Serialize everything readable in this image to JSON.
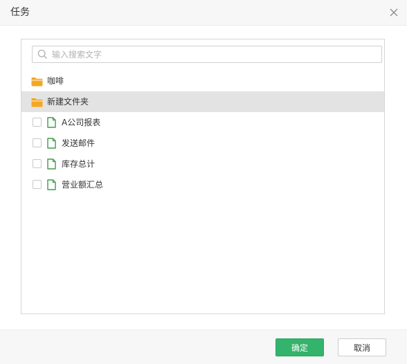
{
  "dialog": {
    "title": "任务"
  },
  "search": {
    "placeholder": "输入搜索文字",
    "value": ""
  },
  "tree": {
    "folders": [
      {
        "label": "咖啡",
        "selected": false
      },
      {
        "label": "新建文件夹",
        "selected": true
      }
    ],
    "files": [
      {
        "label": "A公司报表",
        "checked": false
      },
      {
        "label": "发送邮件",
        "checked": false
      },
      {
        "label": "库存总计",
        "checked": false
      },
      {
        "label": "营业额汇总",
        "checked": false
      }
    ]
  },
  "footer": {
    "ok_label": "确定",
    "cancel_label": "取消"
  },
  "colors": {
    "folder": "#f5a623",
    "file": "#3f9b4a",
    "ok_button": "#33b36b",
    "selected_row": "#e3e3e3"
  },
  "icons": {
    "close": "close-icon",
    "search": "search-icon",
    "folder": "folder-icon",
    "file": "file-icon"
  }
}
